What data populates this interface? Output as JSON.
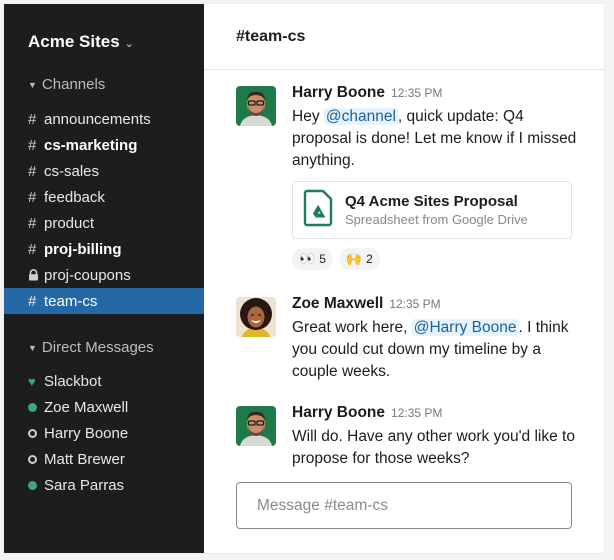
{
  "sidebar": {
    "team_name": "Acme Sites",
    "channels_header": "Channels",
    "channels": [
      {
        "prefix": "#",
        "label": "announcements",
        "bold": false,
        "active": false,
        "private": false
      },
      {
        "prefix": "#",
        "label": "cs-marketing",
        "bold": true,
        "active": false,
        "private": false
      },
      {
        "prefix": "#",
        "label": "cs-sales",
        "bold": false,
        "active": false,
        "private": false
      },
      {
        "prefix": "#",
        "label": "feedback",
        "bold": false,
        "active": false,
        "private": false
      },
      {
        "prefix": "#",
        "label": "product",
        "bold": false,
        "active": false,
        "private": false
      },
      {
        "prefix": "#",
        "label": "proj-billing",
        "bold": true,
        "active": false,
        "private": false
      },
      {
        "prefix": "lock",
        "label": "proj-coupons",
        "bold": false,
        "active": false,
        "private": true
      },
      {
        "prefix": "#",
        "label": "team-cs",
        "bold": false,
        "active": true,
        "private": false
      }
    ],
    "dm_header": "Direct Messages",
    "direct_messages": [
      {
        "label": "Slackbot",
        "status": "bot"
      },
      {
        "label": "Zoe Maxwell",
        "status": "online"
      },
      {
        "label": "Harry Boone",
        "status": "away"
      },
      {
        "label": "Matt Brewer",
        "status": "away"
      },
      {
        "label": "Sara Parras",
        "status": "online"
      }
    ]
  },
  "channel": {
    "title": "#team-cs"
  },
  "messages": [
    {
      "author": "Harry Boone",
      "time": "12:35 PM",
      "text_before": "Hey ",
      "mention": "@channel",
      "text_after": ", quick update: Q4 proposal is done! Let me know if I missed anything.",
      "attachment": {
        "title": "Q4 Acme Sites Proposal",
        "subtitle": "Spreadsheet from Google Drive"
      },
      "reactions": [
        {
          "emoji": "👀",
          "name": "eyes",
          "count": "5"
        },
        {
          "emoji": "🙌",
          "name": "raised-hands",
          "count": "2"
        }
      ]
    },
    {
      "author": "Zoe Maxwell",
      "time": "12:35 PM",
      "text_before": "Great work here, ",
      "mention": "@Harry Boone",
      "text_after": ". I think you could cut down my timeline by a couple weeks."
    },
    {
      "author": "Harry Boone",
      "time": "12:35 PM",
      "text": "Will do. Have any other work you'd like to propose for those weeks?"
    }
  ],
  "composer": {
    "placeholder": "Message #team-cs",
    "value": ""
  },
  "colors": {
    "sidebar_bg": "#1d1d1d",
    "active_channel": "#2469a5",
    "online": "#3aa87b",
    "mention_text": "#1264a3",
    "mention_bg": "#e8f2fb",
    "drive_green": "#1e7d5b"
  }
}
